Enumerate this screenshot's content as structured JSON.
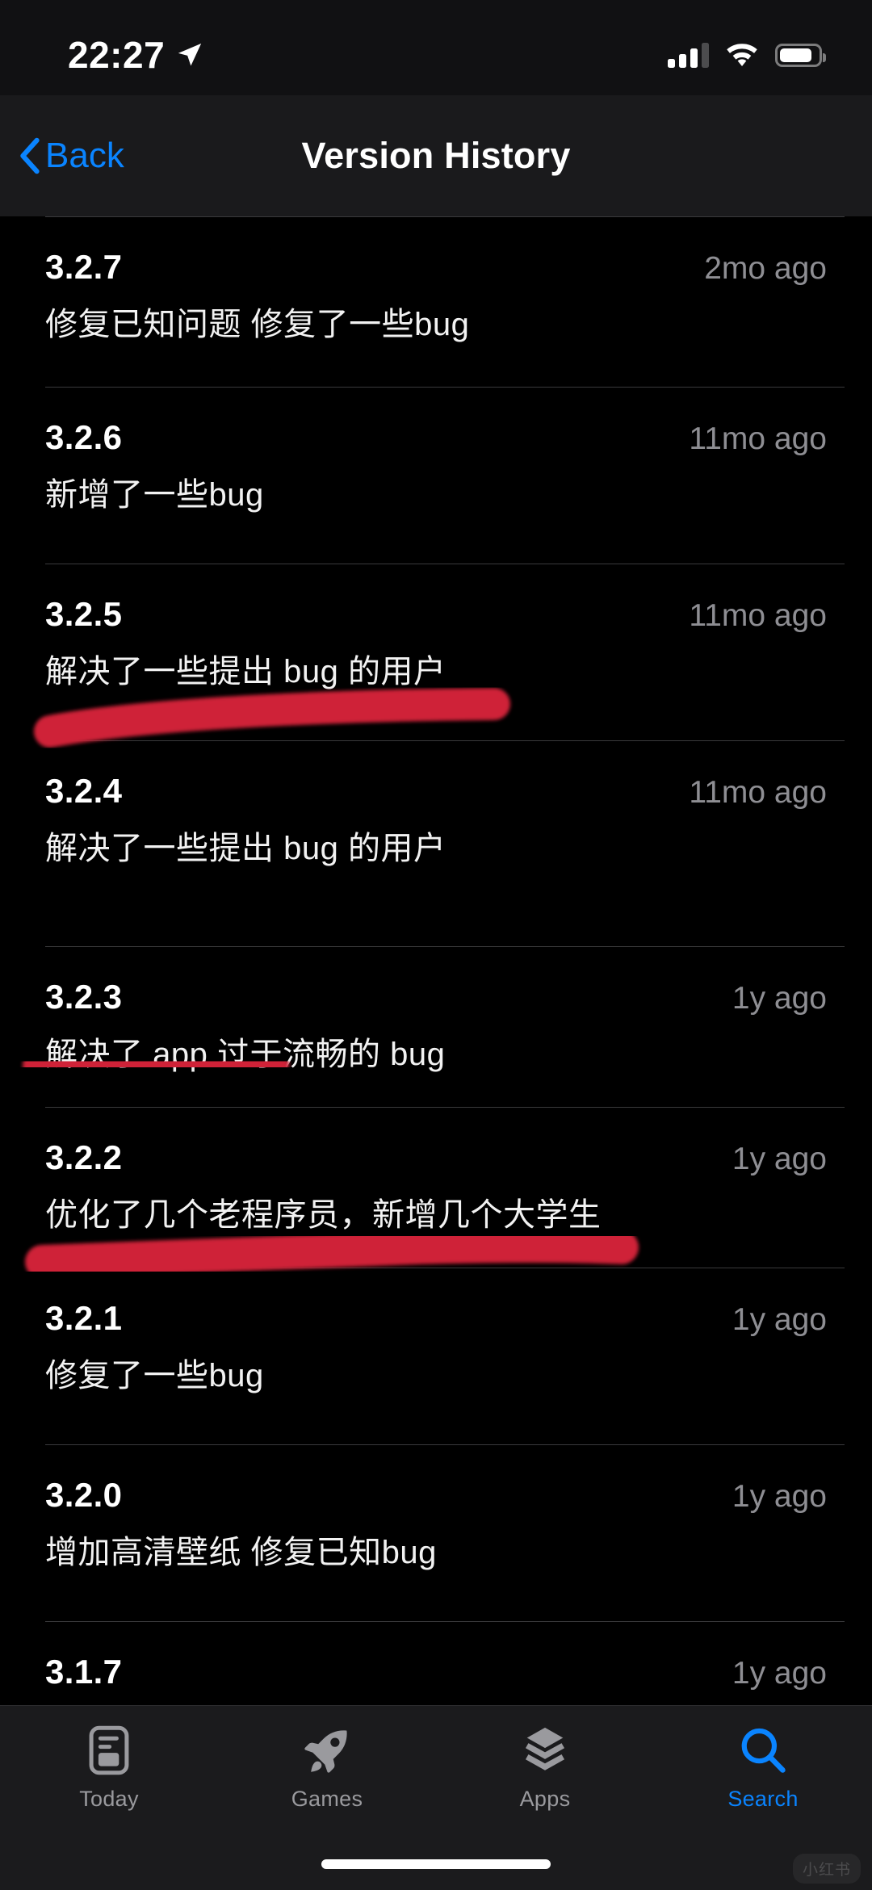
{
  "status_bar": {
    "time": "22:27",
    "location_icon": "location-arrow-icon",
    "signal_icon": "cellular-signal-icon",
    "signal_bars": 3,
    "wifi_icon": "wifi-icon",
    "battery_icon": "battery-icon",
    "battery_level": 75
  },
  "nav": {
    "back_label": "Back",
    "back_icon": "chevron-left-icon",
    "title": "Version History",
    "accent_color": "#0a84ff"
  },
  "annotations": {
    "marker_color": "#cf2038",
    "strokes": [
      {
        "target_version": "3.2.5",
        "shape": "slanted-underline"
      },
      {
        "target_version": "3.2.3",
        "shape": "straight-underline"
      },
      {
        "target_version": "3.2.2",
        "shape": "long-underline"
      }
    ]
  },
  "version_list": {
    "rows": [
      {
        "version": "3.2.7",
        "date": "2mo ago",
        "desc": "修复已知问题 修复了一些bug"
      },
      {
        "version": "3.2.6",
        "date": "11mo ago",
        "desc": "新增了一些bug"
      },
      {
        "version": "3.2.5",
        "date": "11mo ago",
        "desc": "解决了一些提出 bug 的用户"
      },
      {
        "version": "3.2.4",
        "date": "11mo ago",
        "desc": "解决了一些提出 bug 的用户"
      },
      {
        "version": "3.2.3",
        "date": "1y ago",
        "desc": "解决了 app 过于流畅的 bug"
      },
      {
        "version": "3.2.2",
        "date": "1y ago",
        "desc": "优化了几个老程序员，新增几个大学生"
      },
      {
        "version": "3.2.1",
        "date": "1y ago",
        "desc": "修复了一些bug"
      },
      {
        "version": "3.2.0",
        "date": "1y ago",
        "desc": "增加高清壁纸 修复已知bug"
      },
      {
        "version": "3.1.7",
        "date": "1y ago",
        "desc": ""
      }
    ]
  },
  "tab_bar": {
    "tabs": [
      {
        "label": "Today",
        "icon": "today-newspaper-icon",
        "active": false
      },
      {
        "label": "Games",
        "icon": "rocket-icon",
        "active": false
      },
      {
        "label": "Apps",
        "icon": "stacked-layers-icon",
        "active": false
      },
      {
        "label": "Search",
        "icon": "magnifier-icon",
        "active": true
      }
    ]
  },
  "watermark": {
    "text": "小红书"
  }
}
